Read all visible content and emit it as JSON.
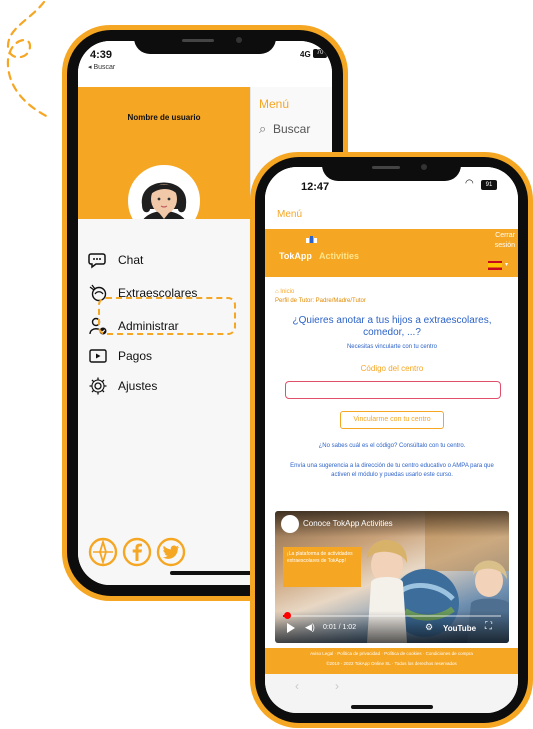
{
  "phone1": {
    "status_time": "4:39",
    "status_back": "◂ Buscar",
    "status_signal": "4G",
    "status_battery": "70",
    "username": "Nombre de usuario",
    "menu": [
      {
        "label": "Chat",
        "icon": "chat-bubble-icon"
      },
      {
        "label": "Extraescolares",
        "icon": "activities-icon"
      },
      {
        "label": "Administrar",
        "icon": "admin-user-icon"
      },
      {
        "label": "Pagos",
        "icon": "payment-icon"
      },
      {
        "label": "Ajustes",
        "icon": "settings-gear-icon"
      }
    ],
    "right_panel": {
      "title": "Menú",
      "search_label": "Buscar"
    },
    "social_icons": [
      "compass-icon",
      "facebook-icon",
      "twitter-icon"
    ]
  },
  "phone2": {
    "status_time": "12:47",
    "status_battery": "91",
    "menu_label": "Menú",
    "logo_part1": "TokApp",
    "logo_part2": "Activities",
    "login_label": "Cerrar sesión",
    "breadcrumb_home": "Inicio",
    "breadcrumb_path": "Perfil de Tutor: Padre/Madre/Tutor",
    "question": "¿Quieres anotar a tus hijos a extraescolares, comedor, ...?",
    "sub_text": "Necesitas vincularte con tu centro",
    "code_label": "Código del centro",
    "code_input_value": "",
    "link_button": "Vincularme con tu centro",
    "help_text": "¿No sabes cuál es el código? Consúltalo con tu centro.",
    "suggest_text": "Envía una sugerencia a la dirección de tu centro educativo o AMPA para que activen el módulo y puedas usarlo este curso.",
    "video": {
      "title": "Conoce TokApp Activities",
      "card_text": "¡La plataforma de actividades extraescolares de TokApp!",
      "time": "0:01 / 1:02",
      "brand": "YouTube",
      "progress": 0.02
    },
    "footer_links": "Aviso Legal · Política de privacidad · Política de cookies · Condiciones de compra",
    "footer_copy": "©2019 - 2022 TokApp Online SL · Todos los derechos reservados"
  }
}
